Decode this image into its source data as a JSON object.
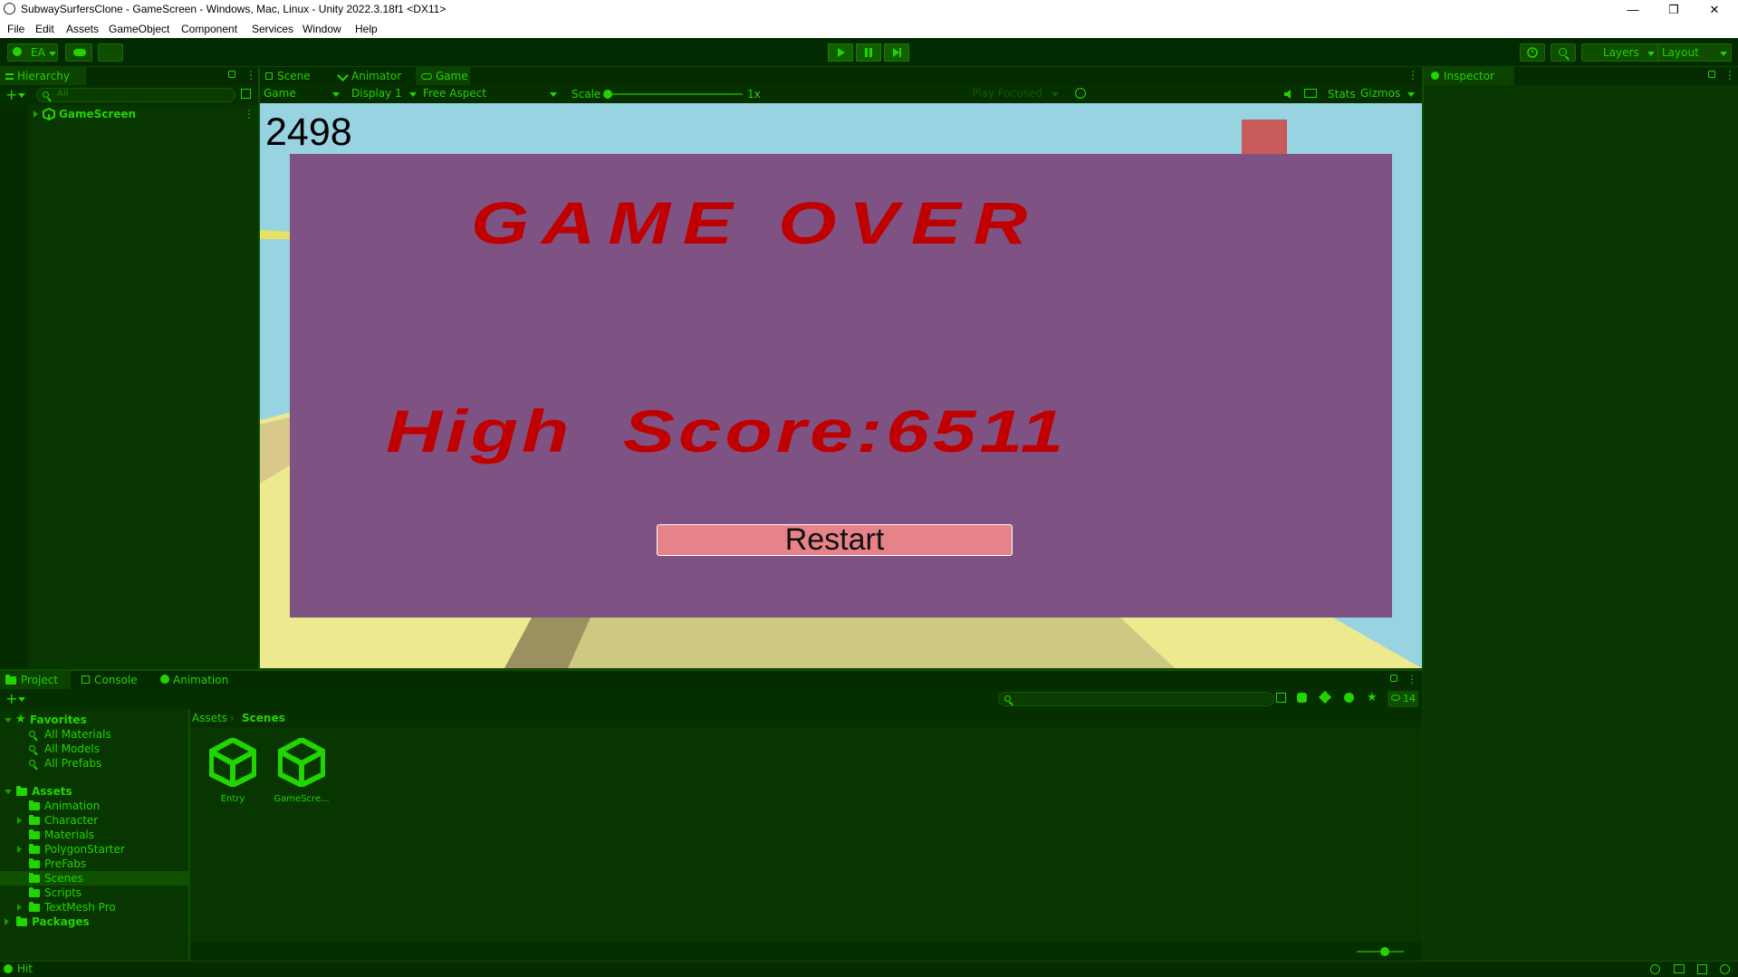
{
  "window": {
    "title": "SubwaySurfersClone - GameScreen - Windows, Mac, Linux - Unity 2022.3.18f1 <DX11>"
  },
  "menu": [
    "File",
    "Edit",
    "Assets",
    "GameObject",
    "Component",
    "Services",
    "Window",
    "Help"
  ],
  "toolbar": {
    "account": "EA",
    "layers": "Layers",
    "layout": "Layout"
  },
  "hierarchy": {
    "tab": "Hierarchy",
    "search_placeholder": "All",
    "items": [
      {
        "label": "GameScreen"
      }
    ]
  },
  "center": {
    "tabs": [
      "Scene",
      "Animator",
      "Game"
    ],
    "active_tab": "Game"
  },
  "game_toolbar": {
    "mode": "Game",
    "display": "Display 1",
    "aspect": "Free Aspect",
    "scale_label": "Scale",
    "scale_value": "1x",
    "play_focused": "Play Focused",
    "stats": "Stats",
    "gizmos": "Gizmos"
  },
  "game": {
    "score": "2498",
    "game_over": "GAME OVER",
    "high_score": "High  Score:6511",
    "restart": "Restart"
  },
  "inspector": {
    "tab": "Inspector"
  },
  "bottom": {
    "tabs": [
      "Project",
      "Console",
      "Animation"
    ],
    "active_tab": "Project",
    "hidden_count": "14",
    "favorites": {
      "label": "Favorites",
      "items": [
        "All Materials",
        "All Models",
        "All Prefabs"
      ]
    },
    "assets": {
      "label": "Assets",
      "children": [
        "Animation",
        "Character",
        "Materials",
        "PolygonStarter",
        "PreFabs",
        "Scenes",
        "Scripts",
        "TextMesh Pro"
      ],
      "selected": "Scenes"
    },
    "packages": "Packages",
    "breadcrumb": [
      "Assets",
      "Scenes"
    ],
    "files": [
      "Entry",
      "GameScre..."
    ]
  },
  "status": {
    "message": "Hit"
  },
  "colors": {
    "accent": "#22d400",
    "panel": "#073600",
    "game_sky": "#98d3e2",
    "overlay": "#7e5383",
    "title_red": "#c00000",
    "button": "#e58388"
  }
}
